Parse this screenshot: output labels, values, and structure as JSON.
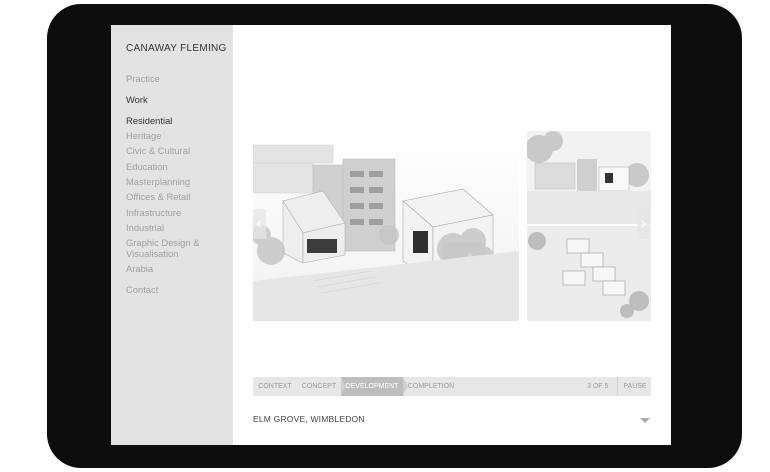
{
  "brand": "CANAWAY FLEMING",
  "nav": {
    "practice": "Practice",
    "work": "Work",
    "contact": "Contact"
  },
  "categories": [
    "Residential",
    "Heritage",
    "Civic & Cultural",
    "Education",
    "Masterplanning",
    "Offices & Retail",
    "Infrastructure",
    "Industrial",
    "Graphic Design &",
    "Visualisation",
    "Arabia"
  ],
  "gallery": {
    "prev_icon": "chevron-left-icon",
    "next_icon": "chevron-right-icon",
    "tabs": [
      "CONTEXT",
      "CONCEPT",
      "DEVELOPMENT",
      "COMPLETION"
    ],
    "active_tab": "DEVELOPMENT",
    "counter": "3 OF 5",
    "pause_label": "PAUSE"
  },
  "project": {
    "title": "ELM GROVE, WIMBLEDON",
    "expand_icon": "triangle-down-icon"
  }
}
